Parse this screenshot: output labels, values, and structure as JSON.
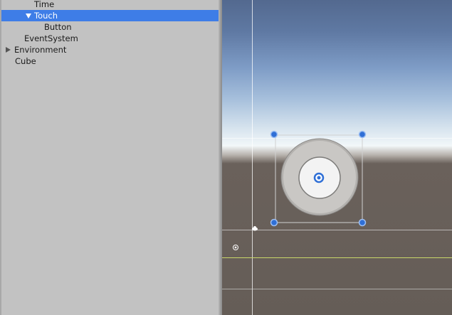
{
  "hierarchy": {
    "items": [
      {
        "label": "Time",
        "state": "none"
      },
      {
        "label": "Touch",
        "state": "expanded",
        "selected": true
      },
      {
        "label": "Button",
        "state": "none"
      },
      {
        "label": "EventSystem",
        "state": "none"
      },
      {
        "label": "Environment",
        "state": "collapsed"
      },
      {
        "label": "Cube",
        "state": "none"
      }
    ]
  },
  "scene": {
    "colors": {
      "selection": "#3e7de7",
      "handle": "#2f6fd6",
      "horizon_line": "#c9d86a"
    },
    "gizmos": [
      "rect-transform-handles",
      "joystick-button",
      "light-icon",
      "pivot-icon"
    ]
  }
}
